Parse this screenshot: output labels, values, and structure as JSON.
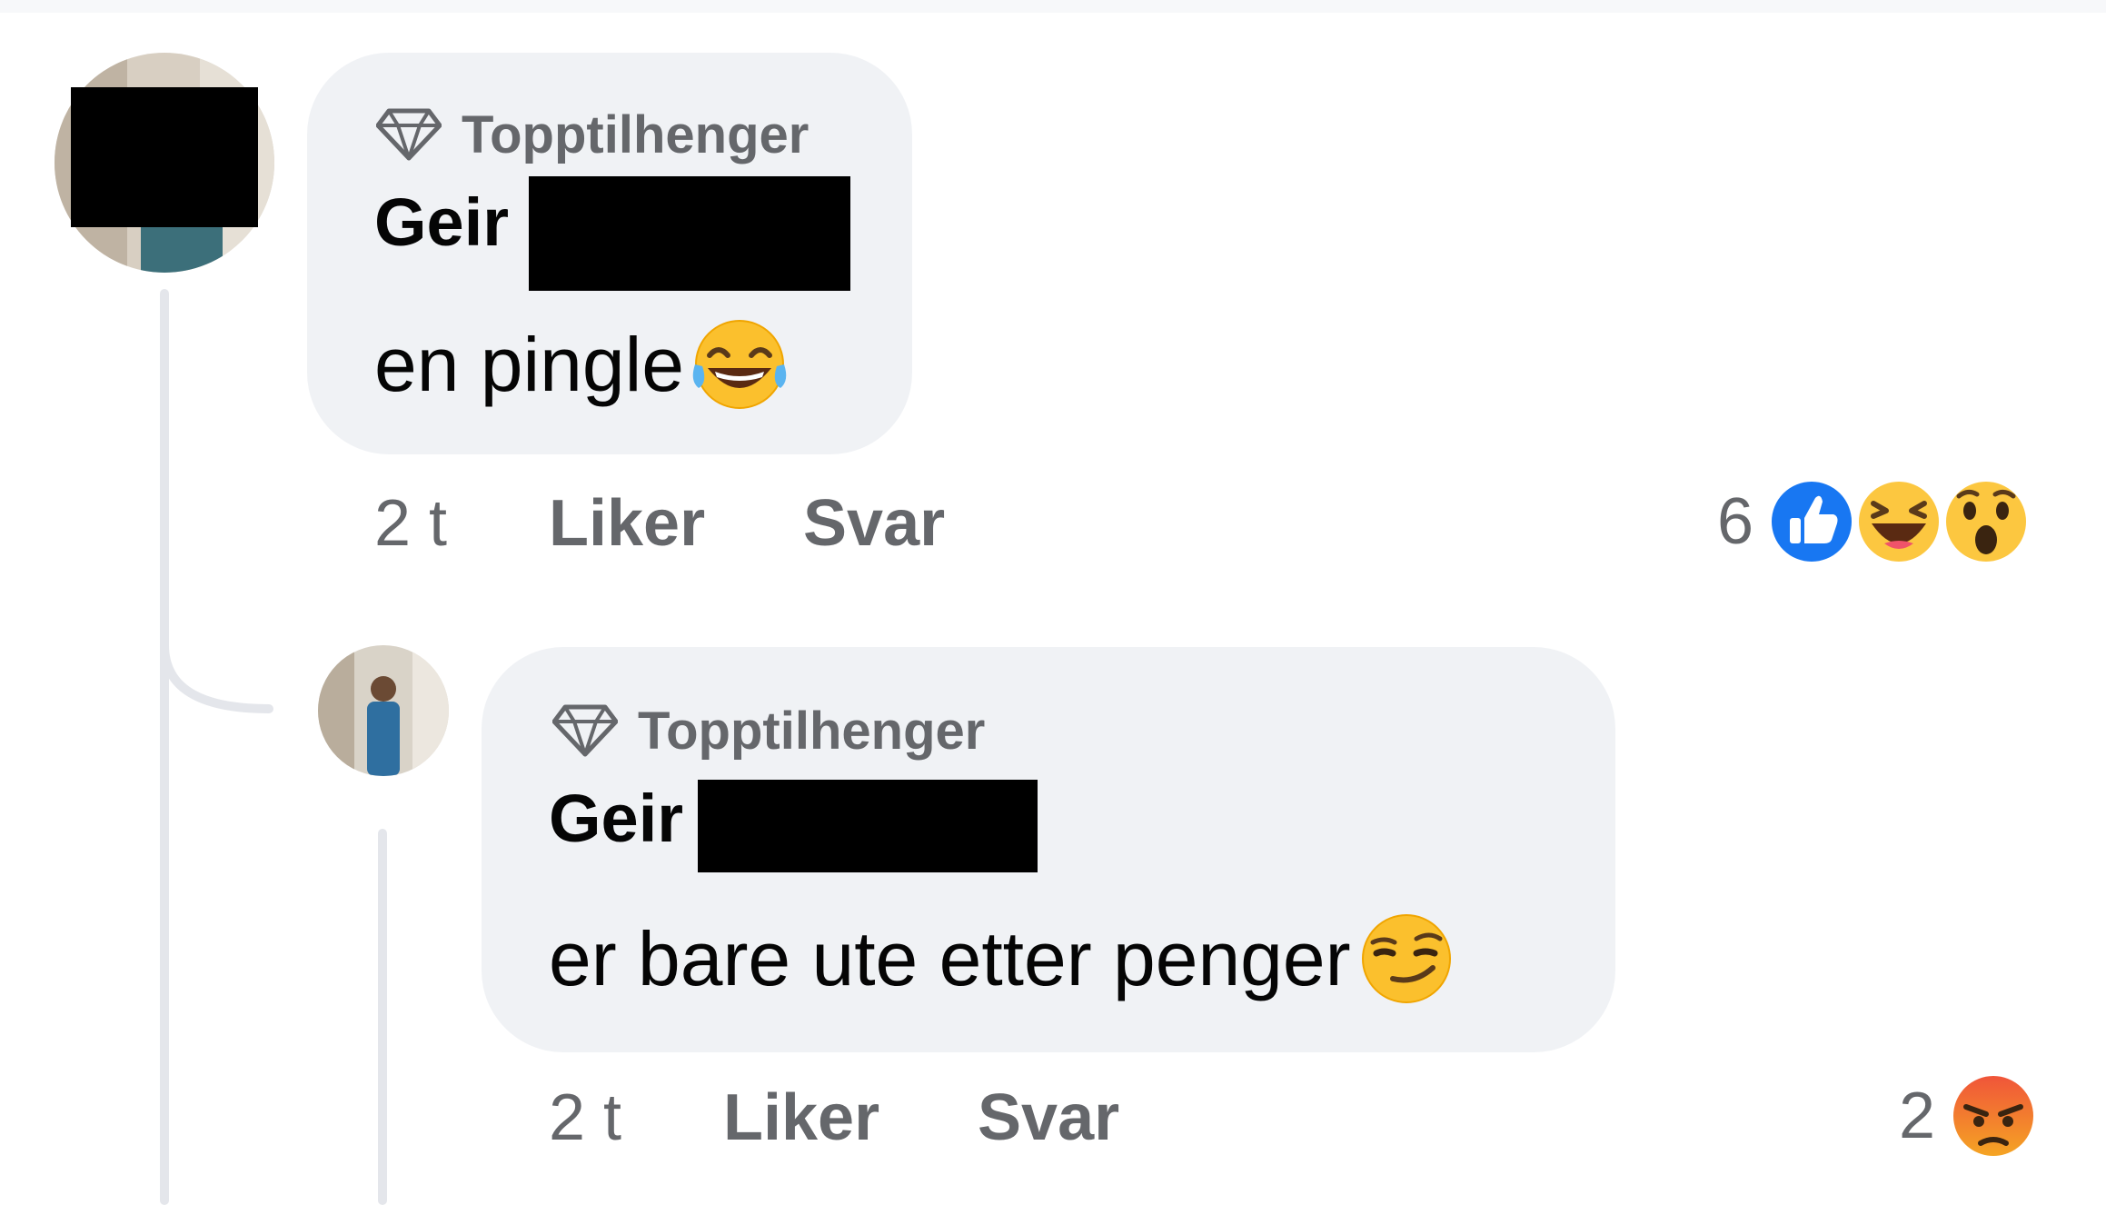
{
  "comments": [
    {
      "badge": "Topptilhenger",
      "author_first": "Geir",
      "text": "en pingle",
      "emoji": "joy-emoji",
      "time": "2 t",
      "like_label": "Liker",
      "reply_label": "Svar",
      "reaction_count": "6",
      "reactions": [
        "like-reaction-icon",
        "haha-reaction-icon",
        "wow-reaction-icon"
      ]
    },
    {
      "badge": "Topptilhenger",
      "author_first": "Geir",
      "text": "er bare ute etter penger",
      "emoji": "smirk-emoji",
      "time": "2 t",
      "like_label": "Liker",
      "reply_label": "Svar",
      "reaction_count": "2",
      "reactions": [
        "angry-reaction-icon"
      ]
    }
  ],
  "colors": {
    "bubble": "#f0f2f5",
    "secondary_text": "#65676b",
    "like_blue": "#1877f2",
    "thread_line": "#e4e6eb"
  }
}
